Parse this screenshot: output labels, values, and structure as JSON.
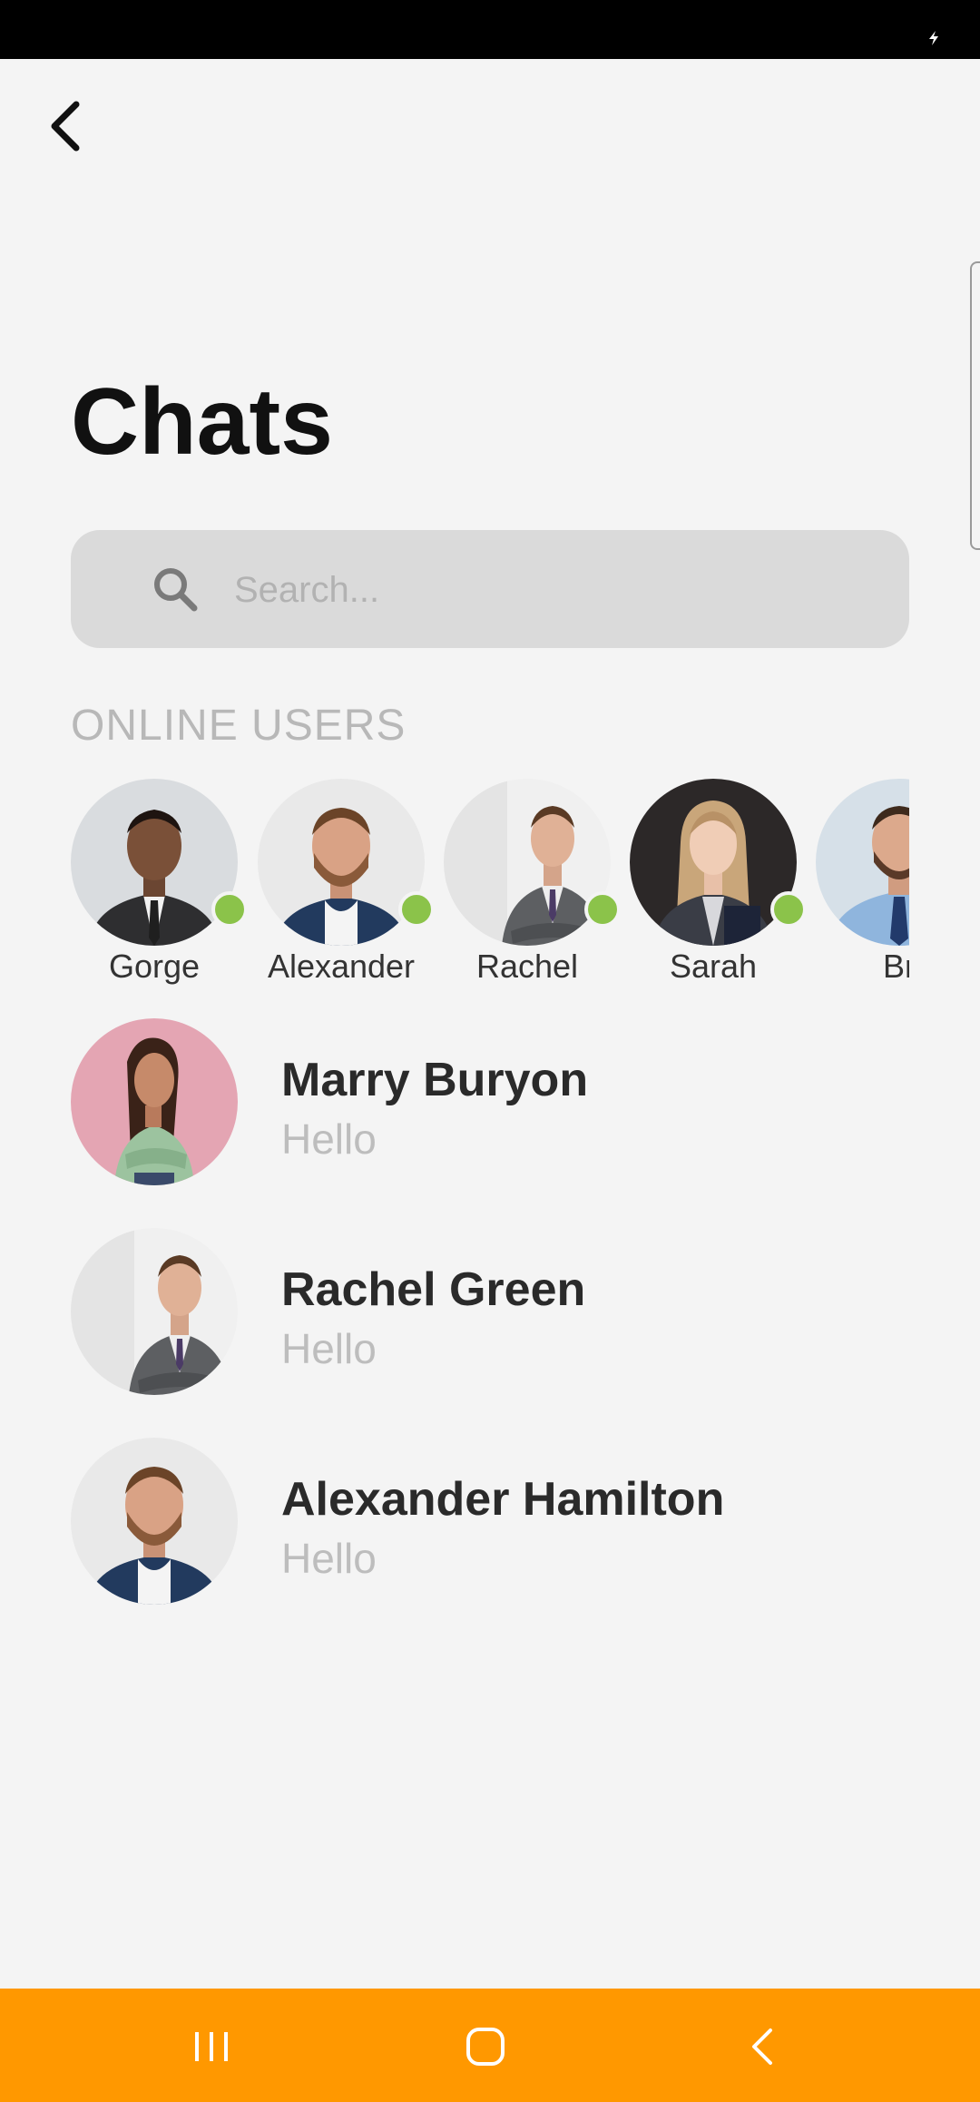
{
  "app": {
    "title": "Chats",
    "accent_color": "#ff9800",
    "online_dot_color": "#8bc34a"
  },
  "header": {
    "back_icon": "chevron-left-icon"
  },
  "search": {
    "placeholder": "Search...",
    "icon": "search-icon"
  },
  "online_section": {
    "label": "ONLINE USERS",
    "users": [
      {
        "name": "Gorge",
        "online": true
      },
      {
        "name": "Alexander",
        "online": true
      },
      {
        "name": "Rachel",
        "online": true
      },
      {
        "name": "Sarah",
        "online": true
      },
      {
        "name": "Br",
        "online": true
      }
    ]
  },
  "chats": [
    {
      "name": "Marry Buryon",
      "last_message": "Hello"
    },
    {
      "name": "Rachel Green",
      "last_message": "Hello"
    },
    {
      "name": "Alexander Hamilton",
      "last_message": "Hello"
    }
  ],
  "system_nav": {
    "recents_icon": "recents-icon",
    "home_icon": "home-icon",
    "back_icon": "back-icon"
  }
}
